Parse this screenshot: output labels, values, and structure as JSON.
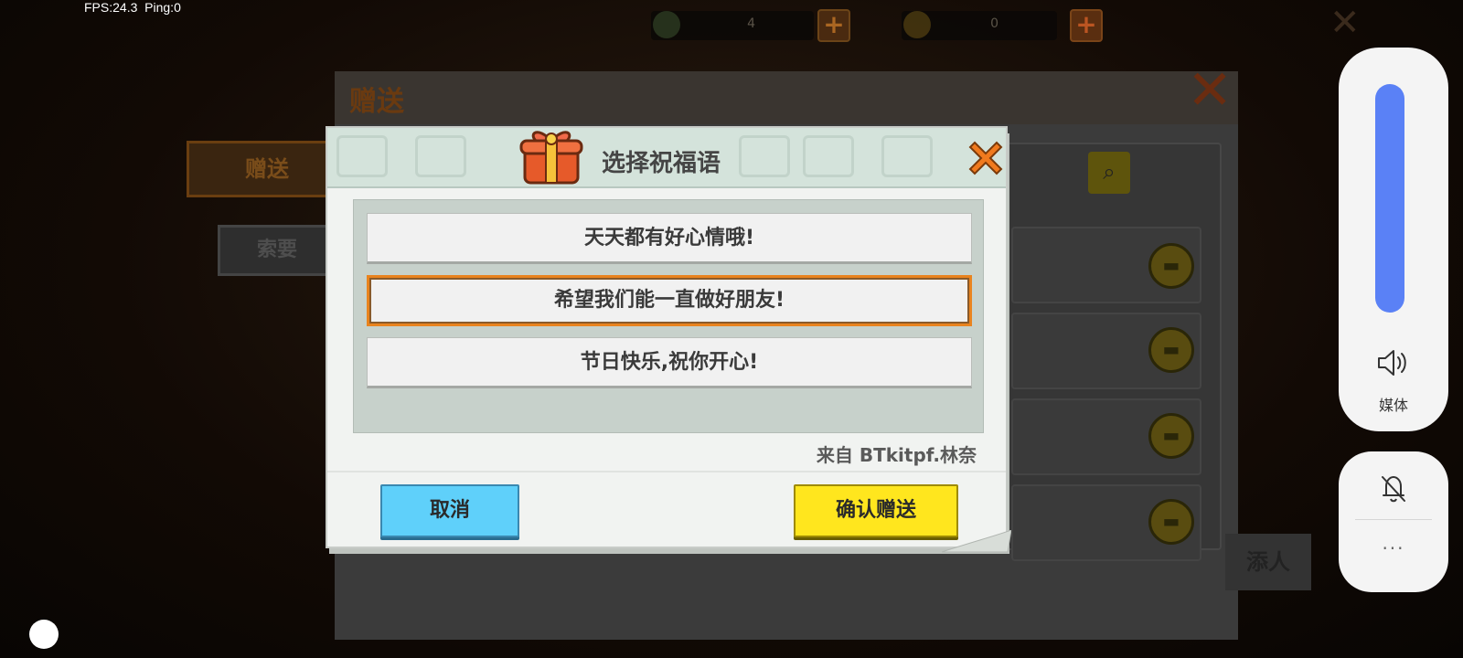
{
  "status": {
    "fps": "FPS:24.3",
    "ping": "Ping:0"
  },
  "currency": [
    {
      "value": "4"
    },
    {
      "value": "0"
    }
  ],
  "background": {
    "panel_title": "赠送",
    "tabs": [
      {
        "label": "赠送"
      },
      {
        "label": "索要"
      }
    ],
    "partial_button_label": "添人"
  },
  "dialog": {
    "title": "选择祝福语",
    "messages": [
      {
        "text": "天天都有好心情哦!"
      },
      {
        "text": "希望我们能一直做好朋友!"
      },
      {
        "text": "节日快乐,祝你开心!"
      }
    ],
    "selected_index": 1,
    "from_label": "来自 BTkitpf.林奈",
    "cancel_label": "取消",
    "confirm_label": "确认赠送"
  },
  "system_overlay": {
    "volume_level": 1.0,
    "media_label": "媒体",
    "more_label": "···"
  },
  "colors": {
    "accent_orange": "#e9831e",
    "cancel_blue": "#5fd0fa",
    "confirm_yellow": "#ffe61e",
    "volume_blue": "#5a81f6"
  }
}
